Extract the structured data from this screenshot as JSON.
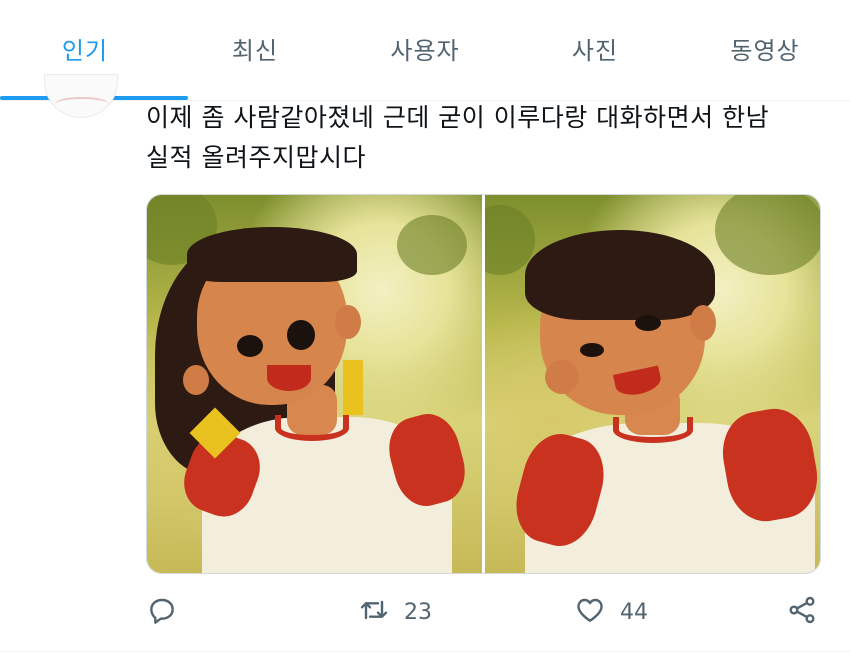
{
  "tabs": [
    {
      "label": "인기",
      "active": true
    },
    {
      "label": "최신"
    },
    {
      "label": "사용자"
    },
    {
      "label": "사진"
    },
    {
      "label": "동영상"
    }
  ],
  "tweet": {
    "text_line1": "이제 좀 사람같아졌네 근데 굳이 이루다랑 대화하면서 한남",
    "text_line2": "실적 올려주지맙시다"
  },
  "actions": {
    "reply_icon": "reply-icon",
    "retweet_icon": "retweet-icon",
    "retweet_count": "23",
    "like_icon": "heart-icon",
    "like_count": "44",
    "share_icon": "share-icon"
  },
  "colors": {
    "accent": "#1d9bf0",
    "muted": "#536471",
    "text": "#0f1419",
    "shirt_red": "#c8321f"
  }
}
